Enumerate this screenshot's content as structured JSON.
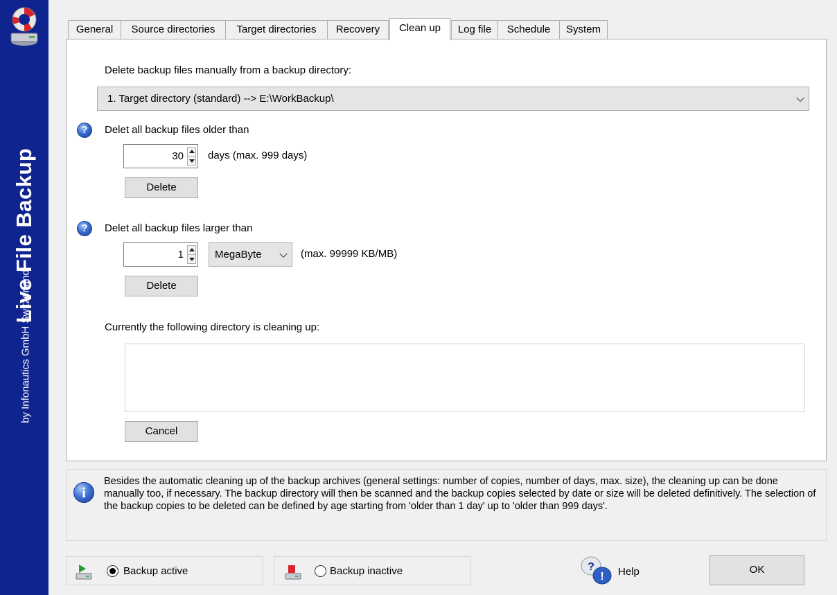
{
  "app": {
    "title": "Live File Backup",
    "subtitle": "by Infonautics GmbH Switzerland"
  },
  "tabs": [
    {
      "label": "General"
    },
    {
      "label": "Source directories"
    },
    {
      "label": "Target directories"
    },
    {
      "label": "Recovery"
    },
    {
      "label": "Clean up",
      "active": true
    },
    {
      "label": "Log file"
    },
    {
      "label": "Schedule"
    },
    {
      "label": "System"
    }
  ],
  "cleanup": {
    "manual_label": "Delete backup files manually from a backup directory:",
    "directory_selected": "1. Target directory (standard) --> E:\\WorkBackup\\",
    "older": {
      "label": "Delet all backup files older than",
      "value": "30",
      "unit_note": "days (max. 999 days)",
      "delete_label": "Delete"
    },
    "larger": {
      "label": "Delet all backup files larger than",
      "value": "1",
      "unit_selected": "MegaByte",
      "limit_note": "(max. 99999 KB/MB)",
      "delete_label": "Delete"
    },
    "current_label": "Currently the following directory is cleaning up:",
    "current_value": "",
    "cancel_label": "Cancel"
  },
  "info": {
    "text": "Besides the automatic cleaning up of the backup archives (general settings: number of copies, number of days, max. size), the cleaning up can be done manually too, if necessary. The backup directory will then be scanned and the backup copies selected by date or size will be deleted definitively. The selection of the backup copies to be deleted can be defined by age starting from 'older than 1 day' up to 'older than 999 days'."
  },
  "footer": {
    "active_label": "Backup active",
    "inactive_label": "Backup inactive",
    "active_selected": true,
    "help_label": "Help",
    "ok_label": "OK"
  },
  "icons": {
    "logo": "lifebuoy-drive-icon",
    "question": "question-mark-icon",
    "info": "info-icon",
    "backup_active": "drive-green-arrow-icon",
    "backup_inactive": "drive-red-icon",
    "help": "help-bubbles-icon"
  },
  "colors": {
    "sidebar": "#10248f",
    "window": "#f0f0f0",
    "panel": "#ffffff",
    "accent_blue": "#2e5fc4"
  }
}
